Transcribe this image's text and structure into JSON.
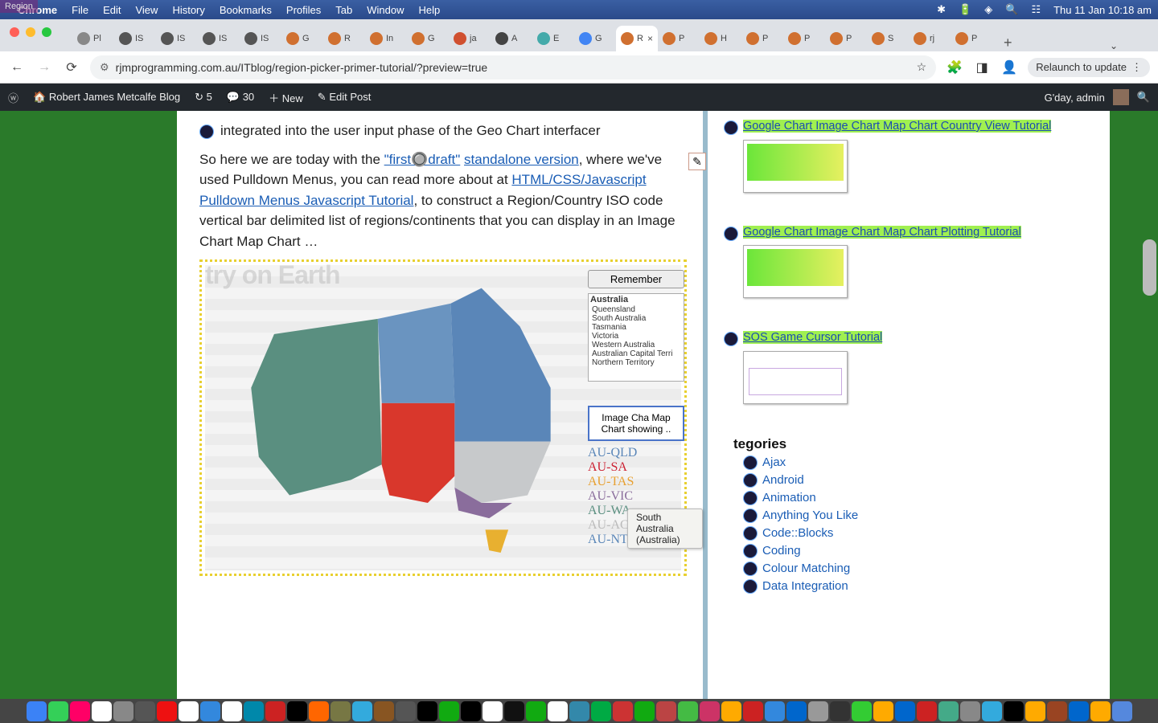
{
  "menubar": {
    "app": "Chrome",
    "items": [
      "File",
      "Edit",
      "View",
      "History",
      "Bookmarks",
      "Profiles",
      "Tab",
      "Window",
      "Help"
    ],
    "overlay": "Region",
    "clock": "Thu 11 Jan  10:18 am"
  },
  "chrome": {
    "tabs": [
      {
        "label": "Pl",
        "fav": "#888"
      },
      {
        "label": "IS",
        "fav": "#555"
      },
      {
        "label": "IS",
        "fav": "#555"
      },
      {
        "label": "IS",
        "fav": "#555"
      },
      {
        "label": "IS",
        "fav": "#555"
      },
      {
        "label": "G",
        "fav": "#d07030"
      },
      {
        "label": "R",
        "fav": "#d07030"
      },
      {
        "label": "In",
        "fav": "#d07030"
      },
      {
        "label": "G",
        "fav": "#d07030"
      },
      {
        "label": "ja",
        "fav": "#d05030"
      },
      {
        "label": "A",
        "fav": "#444"
      },
      {
        "label": "E",
        "fav": "#4aa"
      },
      {
        "label": "G",
        "fav": "#4285f4"
      },
      {
        "label": "R",
        "fav": "#d07030",
        "active": true
      },
      {
        "label": "P",
        "fav": "#d07030"
      },
      {
        "label": "H",
        "fav": "#d07030"
      },
      {
        "label": "P",
        "fav": "#d07030"
      },
      {
        "label": "P",
        "fav": "#d07030"
      },
      {
        "label": "P",
        "fav": "#d07030"
      },
      {
        "label": "S",
        "fav": "#d07030"
      },
      {
        "label": "rj",
        "fav": "#d07030"
      },
      {
        "label": "P",
        "fav": "#d07030"
      }
    ],
    "url": "rjmprogramming.com.au/ITblog/region-picker-primer-tutorial/?preview=true",
    "relaunch": "Relaunch to update"
  },
  "wp": {
    "site": "Robert James Metcalfe Blog",
    "rev": "5",
    "comments": "30",
    "new": "New",
    "edit": "Edit Post",
    "greeting": "G'day, admin"
  },
  "article": {
    "intro_line": "integrated into the user input phase of the Geo Chart interfacer",
    "p1_a": "So here we are today with the ",
    "p1_link1": "\"first🔘draft\"",
    "p1_b": " ",
    "p1_link2": "standalone version",
    "p1_c": ", where we've used Pulldown Menus, you can read more about at ",
    "p1_link3": "HTML/CSS/Javascript Pulldown Menus Javascript Tutorial",
    "p1_d": ", to construct a Region/Country ISO code vertical bar delimited list of regions/continents that you can display in an Image Chart Map Chart …",
    "map_cut_title": "try on Earth"
  },
  "map_panel": {
    "remember": "Remember",
    "group": "Australia",
    "options": [
      "Queensland",
      "South Australia",
      "Tasmania",
      "Victoria",
      "Western Australia",
      "Australian Capital Terri",
      "Northern Territory"
    ],
    "minibox": "Image Cha Map Chart showing ..",
    "iso": [
      {
        "code": "AU-QLD",
        "color": "#5a86b8"
      },
      {
        "code": "AU-SA",
        "color": "#c23"
      },
      {
        "code": "AU-TAS",
        "color": "#e8a030"
      },
      {
        "code": "AU-VIC",
        "color": "#8a6d9c"
      },
      {
        "code": "AU-WA",
        "color": "#5a8f80"
      },
      {
        "code": "AU-ACT",
        "color": "#bbb"
      },
      {
        "code": "AU-NT",
        "color": "#5a86b8"
      }
    ],
    "tooltip": "South Australia (Australia)"
  },
  "sidebar": {
    "links": [
      "Google Chart Image Chart Map Chart Country View Tutorial",
      "Google Chart Image Chart Map Chart Plotting Tutorial",
      "SOS Game Cursor Tutorial"
    ],
    "cat_heading_cut": "tegories",
    "categories": [
      "Ajax",
      "Android",
      "Animation",
      "Anything You Like",
      "Code::Blocks",
      "Coding",
      "Colour Matching",
      "Data Integration"
    ]
  },
  "dock_colors": [
    "#3b82f6",
    "#34d058",
    "#f06",
    "#fff",
    "#888",
    "#555",
    "#e11",
    "#fff",
    "#38d",
    "#fff",
    "#08a",
    "#c22",
    "#000",
    "#f60",
    "#774",
    "#3ad",
    "#852",
    "#555",
    "#000",
    "#1a1",
    "#000",
    "#fff",
    "#111",
    "#1a1",
    "#fff",
    "#38a",
    "#0a4",
    "#c33",
    "#1a1",
    "#b44",
    "#4b4",
    "#c36",
    "#fa0",
    "#c22",
    "#38d",
    "#06c",
    "#999",
    "#333",
    "#3c3",
    "#fa0",
    "#06c",
    "#c22",
    "#4a8",
    "#888",
    "#3ad",
    "#000",
    "#fa0",
    "#942",
    "#06c",
    "#fa0",
    "#58d"
  ]
}
